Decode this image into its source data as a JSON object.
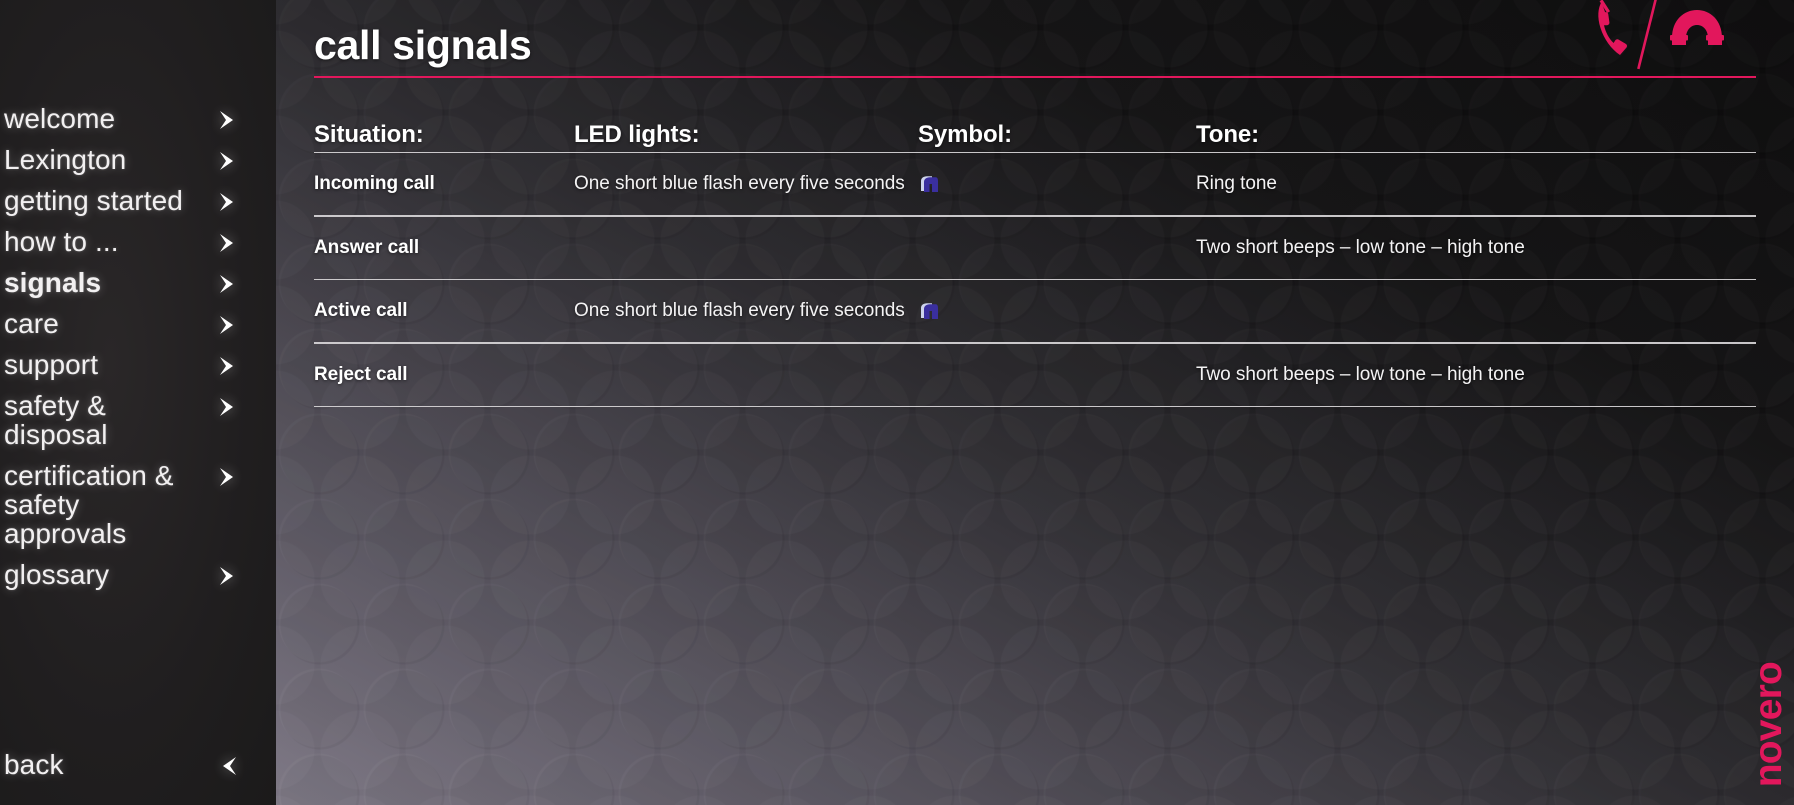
{
  "sidebar": {
    "items": [
      {
        "label": "welcome",
        "icon": "chevron-right-icon",
        "active": false
      },
      {
        "label": "Lexington",
        "icon": "chevron-right-icon",
        "active": false
      },
      {
        "label": "getting started",
        "icon": "chevron-right-icon",
        "active": false
      },
      {
        "label": "how to ...",
        "icon": "chevron-right-icon",
        "active": false
      },
      {
        "label": "signals",
        "icon": "chevron-right-icon",
        "active": true
      },
      {
        "label": "care",
        "icon": "chevron-right-icon",
        "active": false
      },
      {
        "label": "support",
        "icon": "chevron-right-icon",
        "active": false
      },
      {
        "label": "safety & disposal",
        "icon": "chevron-right-icon",
        "active": false
      },
      {
        "label": "certification &\nsafety approvals",
        "icon": "chevron-right-icon",
        "active": false
      },
      {
        "label": "glossary",
        "icon": "chevron-right-icon",
        "active": false
      }
    ],
    "back": {
      "label": "back",
      "icon": "chevron-left-icon"
    }
  },
  "header": {
    "title": "call signals",
    "icons": [
      "phone-handset-icon",
      "slash-divider-icon",
      "phone-hangup-icon"
    ],
    "rule_color": "#e2175c"
  },
  "table": {
    "columns": [
      "Situation:",
      "LED lights:",
      "Symbol:",
      "Tone:"
    ],
    "rows": [
      {
        "situation": "Incoming call",
        "led": "One short blue flash every five seconds",
        "symbol": "blue-led-icon",
        "tone": "Ring tone"
      },
      {
        "situation": "Answer call",
        "led": "",
        "symbol": "",
        "tone": "Two short beeps – low tone – high tone"
      },
      {
        "situation": "Active call",
        "led": "One short blue flash every five seconds",
        "symbol": "blue-led-icon",
        "tone": ""
      },
      {
        "situation": "Reject call",
        "led": "",
        "symbol": "",
        "tone": "Two short beeps – low tone – high tone"
      }
    ]
  },
  "brand": {
    "name": "novero",
    "mark": "·",
    "color": "#e2175c"
  },
  "colors": {
    "accent_pink": "#e2175c",
    "sidebar_bg": "#211f20",
    "text_white": "#ffffff",
    "divider": "#d8d6d8",
    "led_blue": "#3a2f9e"
  }
}
